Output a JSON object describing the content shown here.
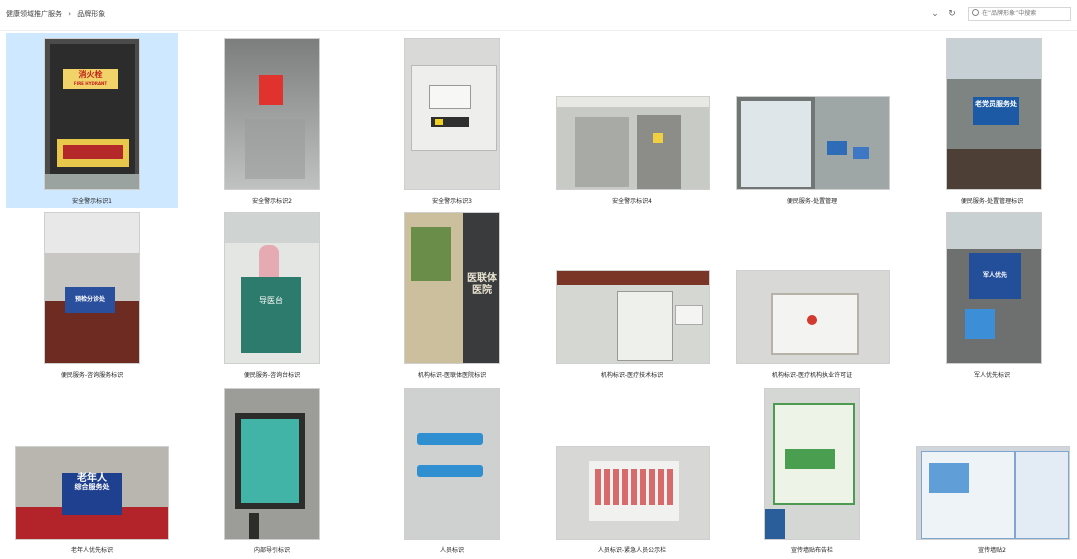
{
  "breadcrumb": [
    "健康领域推广服务",
    "›",
    "品牌形象"
  ],
  "toolbar": {
    "dropdown_icon": "chevron-down-icon",
    "refresh_icon": "refresh-icon"
  },
  "search": {
    "placeholder": "在“品牌形象”中搜索"
  },
  "items": [
    {
      "caption": "安全警示标识1"
    },
    {
      "caption": "安全警示标识2"
    },
    {
      "caption": "安全警示标识3"
    },
    {
      "caption": "安全警示标识4"
    },
    {
      "caption": "便民服务-处置管理"
    },
    {
      "caption": "便民服务-处置管理标识"
    },
    {
      "caption": "便民服务-咨询服务标识"
    },
    {
      "caption": "便民服务-咨询台标识"
    },
    {
      "caption": "机构标识-医联体医院标识"
    },
    {
      "caption": "机构标识-医疗技术标识"
    },
    {
      "caption": "机构标识-医疗机构执业许可证"
    },
    {
      "caption": "军人优先标识"
    },
    {
      "caption": "老年人优先标识"
    },
    {
      "caption": "内部导引标识"
    },
    {
      "caption": "人员标识"
    },
    {
      "caption": "人员标识-紧急人员公示栏"
    },
    {
      "caption": "宣传墙贴布告栏"
    },
    {
      "caption": "宣传墙贴2"
    }
  ],
  "photo_text": {
    "fire_hydrant": "消火栓",
    "fire_hydrant_en": "FIRE HYDRANT",
    "help_desk": "导医台",
    "consult": "预检分诊处",
    "medical_union": "医联体医院",
    "elderly_1": "老年人",
    "elderly_2": "综合服务处",
    "veteran": "老党员服务处",
    "veteran_2": "军人优先"
  }
}
